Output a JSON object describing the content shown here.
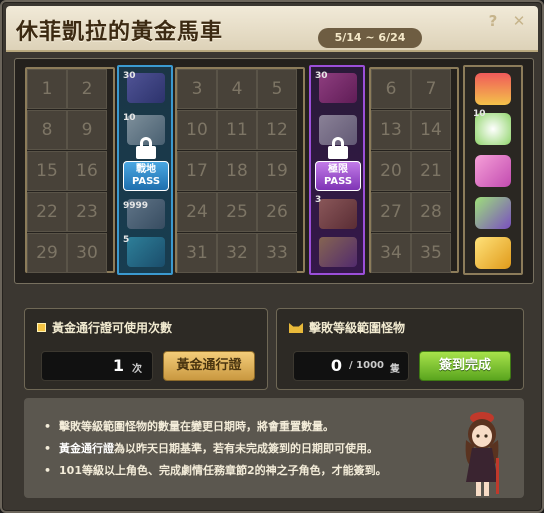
{
  "header": {
    "title": "休菲凱拉的黃金馬車",
    "date_range": "5/14 ~ 6/24",
    "help_glyph": "?",
    "close_glyph": "✕"
  },
  "board": {
    "group1": [
      "1",
      "2",
      "8",
      "9",
      "15",
      "16",
      "22",
      "23",
      "29",
      "30"
    ],
    "group2": [
      "3",
      "4",
      "5",
      "10",
      "11",
      "12",
      "17",
      "18",
      "19",
      "24",
      "25",
      "26",
      "31",
      "32",
      "33"
    ],
    "group3": [
      "6",
      "7",
      "13",
      "14",
      "20",
      "21",
      "27",
      "28",
      "34",
      "35"
    ],
    "blue_column": {
      "pass_label_line1": "戰地",
      "pass_label_line2": "PASS",
      "item_tags": [
        "30",
        "10",
        "",
        "9999",
        "5"
      ]
    },
    "purple_column": {
      "pass_label_line1": "極限",
      "pass_label_line2": "PASS",
      "item_tags": [
        "30",
        "",
        "",
        "3",
        ""
      ]
    },
    "gold_rewards": [
      "treasure-chest-icon",
      "orb-bundle-icon",
      "pink-gift-box-icon",
      "green-gift-box-icon",
      "golden-gift-box-icon"
    ],
    "gold_reward_tags": [
      "",
      "10",
      "",
      "",
      ""
    ]
  },
  "pass_panel": {
    "title": "黃金通行證可使用次數",
    "count": "1",
    "unit": "次",
    "button_label": "黃金通行證"
  },
  "monster_panel": {
    "title": "擊敗等級範圍怪物",
    "count": "0",
    "total": "/ 1000",
    "unit": "隻",
    "button_label": "簽到完成"
  },
  "info": {
    "line1": "擊敗等級範圍怪物的數量在變更日期時，將會重置數量。",
    "line2_bold": "黃金通行證",
    "line2_rest": "為以昨天日期基準，若有未完成簽到的日期即可使用。",
    "line3": "101等級以上角色、完成劇情任務章節2的神之子角色，才能簽到。"
  },
  "colors": {
    "accent_blue": "#3b9ad0",
    "accent_purple": "#9b4fd9",
    "gold": "#f5c443",
    "green_button": "#5aa51e"
  }
}
